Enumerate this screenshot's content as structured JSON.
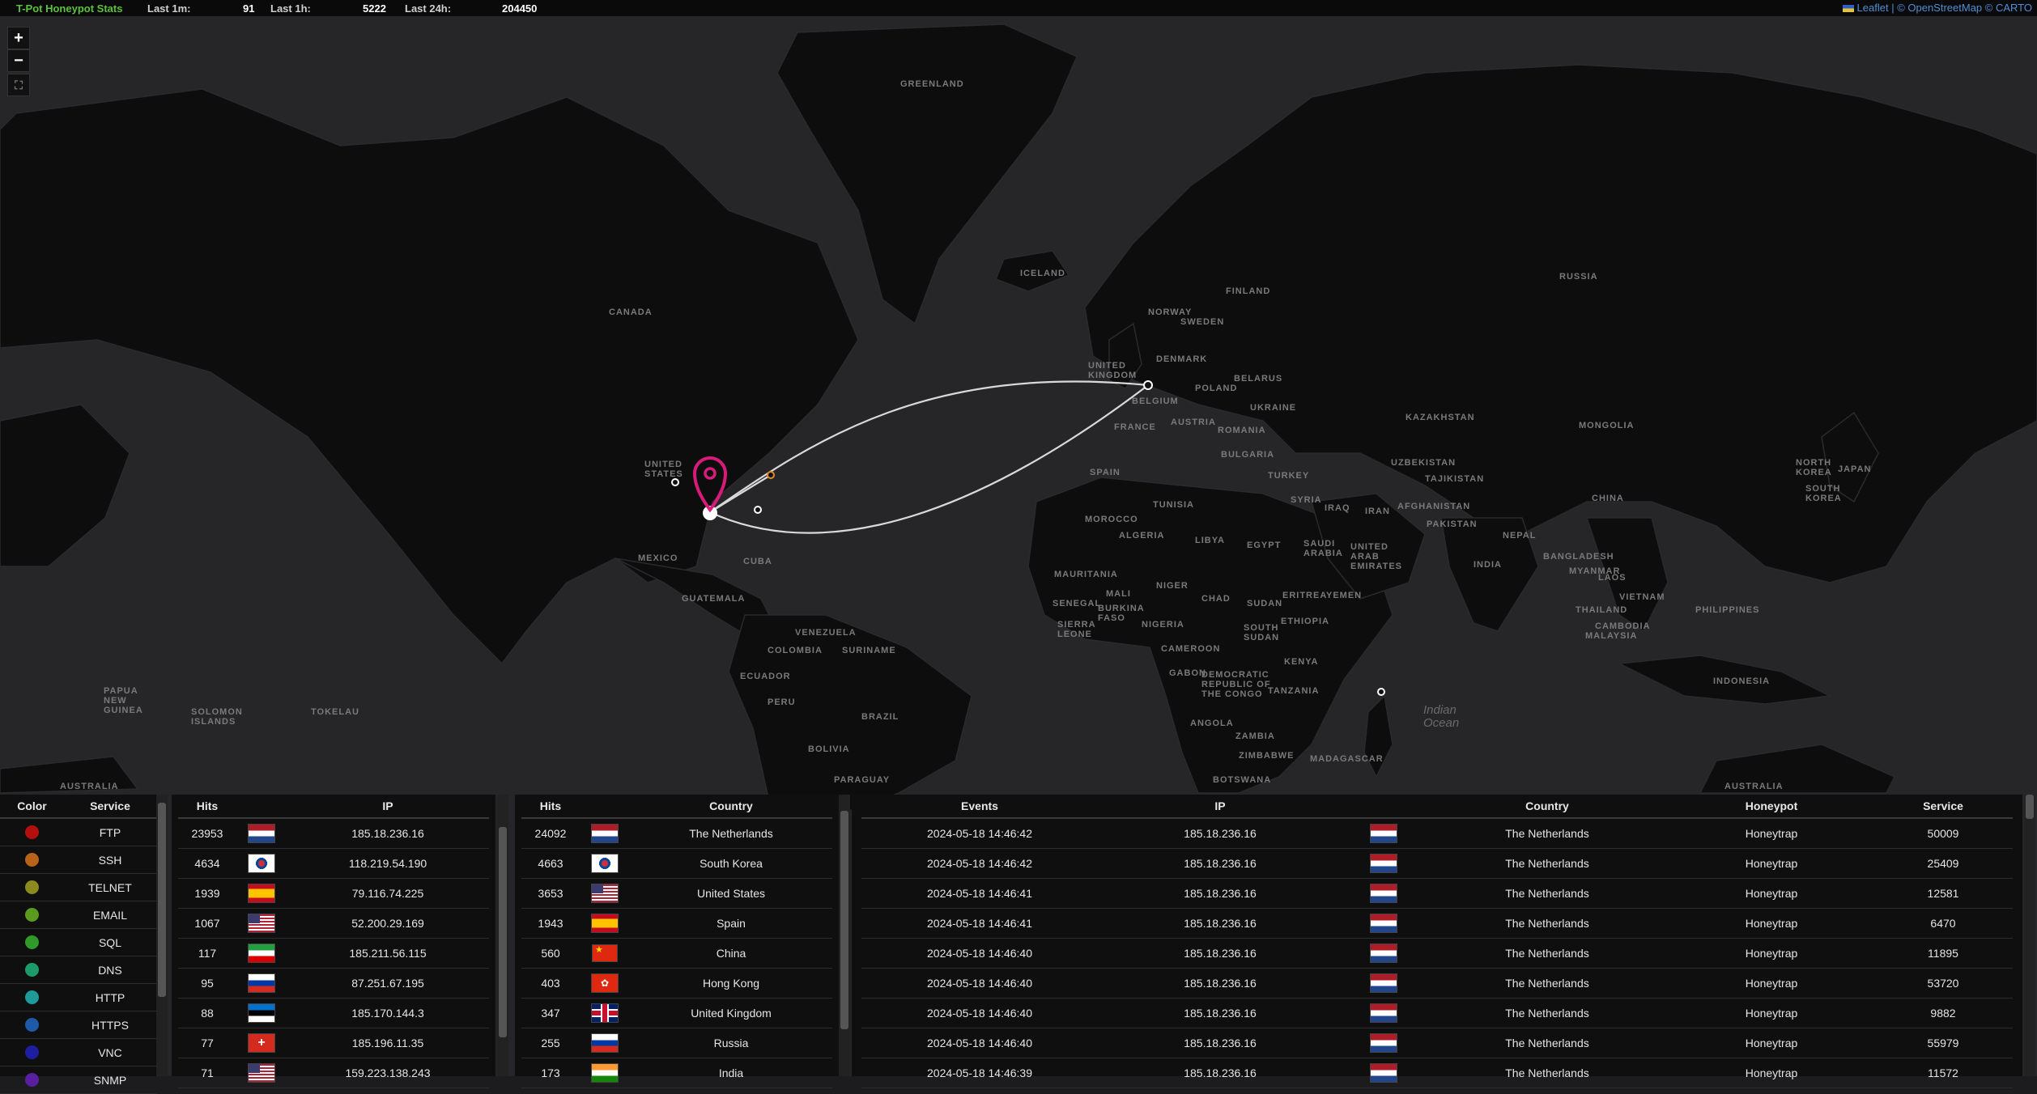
{
  "header": {
    "title": "T-Pot Honeypot Stats",
    "last1m_label": "Last 1m:",
    "last1m_value": "91",
    "last1h_label": "Last 1h:",
    "last1h_value": "5222",
    "last24h_label": "Last 24h:",
    "last24h_value": "204450",
    "attribution_leaflet": "Leaflet",
    "attribution_rest": "| © OpenStreetMap © CARTO"
  },
  "map_controls": {
    "zoom_in": "+",
    "zoom_out": "−",
    "fullscreen": "⛶"
  },
  "map_labels": {
    "greenland": "GREENLAND",
    "iceland": "ICELAND",
    "canada": "CANADA",
    "russia": "RUSSIA",
    "finland": "FINLAND",
    "sweden": "SWEDEN",
    "norway": "NORWAY",
    "denmark": "DENMARK",
    "united_kingdom": "UNITED KINGDOM",
    "belarus": "BELARUS",
    "poland": "POLAND",
    "belgium": "BELGIUM",
    "ukraine": "UKRAINE",
    "france": "FRANCE",
    "austria": "AUSTRIA",
    "romania": "ROMANIA",
    "bulgaria": "BULGARIA",
    "spain": "SPAIN",
    "turkey": "TURKEY",
    "kazakhstan": "KAZAKHSTAN",
    "mongolia": "MONGOLIA",
    "uzbekistan": "UZBEKISTAN",
    "tajikistan": "TAJIKISTAN",
    "afghanistan": "AFGHANISTAN",
    "pakistan": "PAKISTAN",
    "china": "CHINA",
    "iran": "IRAN",
    "iraq": "IRAQ",
    "syria": "SYRIA",
    "tunisia": "TUNISIA",
    "morocco": "MOROCCO",
    "algeria": "ALGERIA",
    "libya": "LIBYA",
    "egypt": "EGYPT",
    "saudi_arabia": "SAUDI ARABIA",
    "uae": "UNITED ARAB EMIRATES",
    "yemen": "YEMEN",
    "india": "INDIA",
    "nepal": "NEPAL",
    "bangladesh": "BANGLADESH",
    "myanmar": "MYANMAR",
    "laos": "LAOS",
    "vietnam": "VIETNAM",
    "thailand": "THAILAND",
    "cambodia": "CAMBODIA",
    "malaysia": "MALAYSIA",
    "philippines": "PHILIPPINES",
    "indonesia": "INDONESIA",
    "japan": "JAPAN",
    "north_korea": "NORTH KOREA",
    "south_korea": "SOUTH KOREA",
    "mauritania": "MAURITANIA",
    "mali": "MALI",
    "niger": "NIGER",
    "chad": "CHAD",
    "sudan": "SUDAN",
    "eritrea": "ERITREA",
    "ethiopia": "ETHIOPIA",
    "senegal": "SENEGAL",
    "burkina_faso": "BURKINA FASO",
    "nigeria": "NIGERIA",
    "sierra_leone": "SIERRA LEONE",
    "south_sudan": "SOUTH SUDAN",
    "cameroon": "CAMEROON",
    "gabon": "GABON",
    "drc": "DEMOCRATIC REPUBLIC OF THE CONGO",
    "kenya": "KENYA",
    "tanzania": "TANZANIA",
    "angola": "ANGOLA",
    "zambia": "ZAMBIA",
    "zimbabwe": "ZIMBABWE",
    "botswana": "BOTSWANA",
    "madagascar": "MADAGASCAR",
    "united_states": "UNITED STATES",
    "mexico": "MEXICO",
    "guatemala": "GUATEMALA",
    "cuba": "CUBA",
    "venezuela": "VENEZUELA",
    "colombia": "COLOMBIA",
    "suriname": "SURINAME",
    "ecuador": "ECUADOR",
    "peru": "PERU",
    "brazil": "BRAZIL",
    "bolivia": "BOLIVIA",
    "paraguay": "PARAGUAY",
    "australia": "AUSTRALIA",
    "papua": "PAPUA NEW GUINEA",
    "solomon": "SOLOMON ISLANDS",
    "tokelau": "TOKELAU",
    "indian_ocean": "Indian\nOcean"
  },
  "services_table": {
    "headers": [
      "Color",
      "Service"
    ],
    "rows": [
      {
        "color": "#b40f0f",
        "service": "FTP"
      },
      {
        "color": "#b8621a",
        "service": "SSH"
      },
      {
        "color": "#8a8a1e",
        "service": "TELNET"
      },
      {
        "color": "#5a9a1e",
        "service": "EMAIL"
      },
      {
        "color": "#2f9a2a",
        "service": "SQL"
      },
      {
        "color": "#1e9a6a",
        "service": "DNS"
      },
      {
        "color": "#1e9a9a",
        "service": "HTTP"
      },
      {
        "color": "#1e5aa8",
        "service": "HTTPS"
      },
      {
        "color": "#1e1ea0",
        "service": "VNC"
      },
      {
        "color": "#5a1ea0",
        "service": "SNMP"
      }
    ]
  },
  "ip_table": {
    "headers": [
      "Hits",
      "",
      "IP"
    ],
    "rows": [
      {
        "hits": "23953",
        "flag": "nl",
        "ip": "185.18.236.16"
      },
      {
        "hits": "4634",
        "flag": "kr",
        "ip": "118.219.54.190"
      },
      {
        "hits": "1939",
        "flag": "es",
        "ip": "79.116.74.225"
      },
      {
        "hits": "1067",
        "flag": "us",
        "ip": "52.200.29.169"
      },
      {
        "hits": "117",
        "flag": "ir",
        "ip": "185.211.56.115"
      },
      {
        "hits": "95",
        "flag": "ru",
        "ip": "87.251.67.195"
      },
      {
        "hits": "88",
        "flag": "ee",
        "ip": "185.170.144.3"
      },
      {
        "hits": "77",
        "flag": "ch",
        "ip": "185.196.11.35"
      },
      {
        "hits": "71",
        "flag": "us",
        "ip": "159.223.138.243"
      }
    ]
  },
  "country_table": {
    "headers": [
      "Hits",
      "",
      "Country"
    ],
    "rows": [
      {
        "hits": "24092",
        "flag": "nl",
        "country": "The Netherlands"
      },
      {
        "hits": "4663",
        "flag": "kr",
        "country": "South Korea"
      },
      {
        "hits": "3653",
        "flag": "us",
        "country": "United States"
      },
      {
        "hits": "1943",
        "flag": "es",
        "country": "Spain"
      },
      {
        "hits": "560",
        "flag": "cn",
        "country": "China"
      },
      {
        "hits": "403",
        "flag": "hk",
        "country": "Hong Kong"
      },
      {
        "hits": "347",
        "flag": "gb",
        "country": "United Kingdom"
      },
      {
        "hits": "255",
        "flag": "ru",
        "country": "Russia"
      },
      {
        "hits": "173",
        "flag": "in",
        "country": "India"
      }
    ]
  },
  "events_table": {
    "headers": [
      "Events",
      "IP",
      "",
      "Country",
      "Honeypot",
      "Service"
    ],
    "rows": [
      {
        "time": "2024-05-18 14:46:42",
        "ip": "185.18.236.16",
        "flag": "nl",
        "country": "The Netherlands",
        "honeypot": "Honeytrap",
        "service": "50009"
      },
      {
        "time": "2024-05-18 14:46:42",
        "ip": "185.18.236.16",
        "flag": "nl",
        "country": "The Netherlands",
        "honeypot": "Honeytrap",
        "service": "25409"
      },
      {
        "time": "2024-05-18 14:46:41",
        "ip": "185.18.236.16",
        "flag": "nl",
        "country": "The Netherlands",
        "honeypot": "Honeytrap",
        "service": "12581"
      },
      {
        "time": "2024-05-18 14:46:41",
        "ip": "185.18.236.16",
        "flag": "nl",
        "country": "The Netherlands",
        "honeypot": "Honeytrap",
        "service": "6470"
      },
      {
        "time": "2024-05-18 14:46:40",
        "ip": "185.18.236.16",
        "flag": "nl",
        "country": "The Netherlands",
        "honeypot": "Honeytrap",
        "service": "11895"
      },
      {
        "time": "2024-05-18 14:46:40",
        "ip": "185.18.236.16",
        "flag": "nl",
        "country": "The Netherlands",
        "honeypot": "Honeytrap",
        "service": "53720"
      },
      {
        "time": "2024-05-18 14:46:40",
        "ip": "185.18.236.16",
        "flag": "nl",
        "country": "The Netherlands",
        "honeypot": "Honeytrap",
        "service": "9882"
      },
      {
        "time": "2024-05-18 14:46:40",
        "ip": "185.18.236.16",
        "flag": "nl",
        "country": "The Netherlands",
        "honeypot": "Honeytrap",
        "service": "55979"
      },
      {
        "time": "2024-05-18 14:46:39",
        "ip": "185.18.236.16",
        "flag": "nl",
        "country": "The Netherlands",
        "honeypot": "Honeytrap",
        "service": "11572"
      }
    ]
  }
}
